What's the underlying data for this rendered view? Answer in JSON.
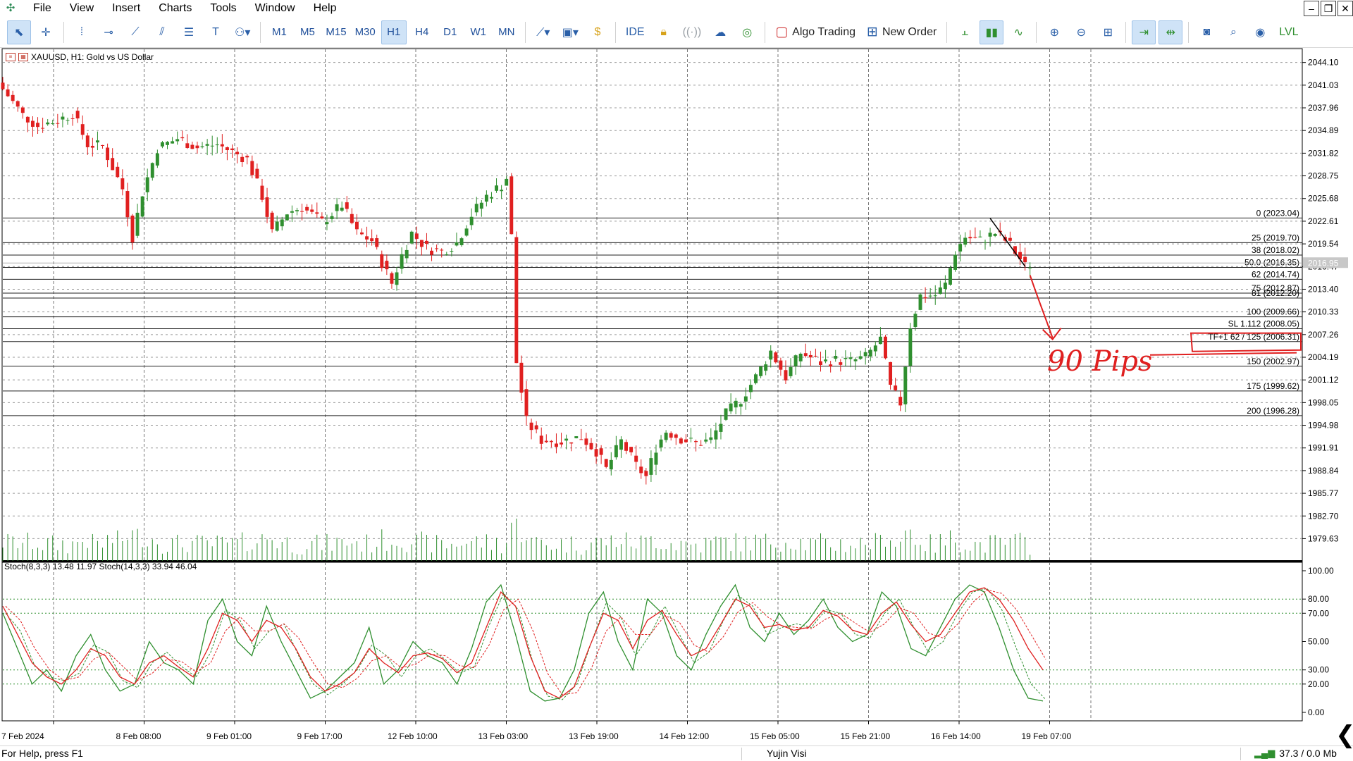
{
  "menu": {
    "items": [
      "File",
      "View",
      "Insert",
      "Charts",
      "Tools",
      "Window",
      "Help"
    ]
  },
  "toolbar": {
    "timeframes": [
      "M1",
      "M5",
      "M15",
      "M30",
      "H1",
      "H4",
      "D1",
      "W1",
      "MN"
    ],
    "active_timeframe": "H1",
    "ide_label": "IDE",
    "algo_trading_label": "Algo Trading",
    "new_order_label": "New Order"
  },
  "chart": {
    "title": "XAUUSD, H1:  Gold vs US Dollar",
    "current_price_label": "2016.95",
    "accent_up": "#2f8f2f",
    "accent_down": "#e02020"
  },
  "chart_data": {
    "type": "candlestick",
    "symbol": "XAUUSD",
    "timeframe": "H1",
    "title": "XAUUSD, H1:  Gold vs US Dollar",
    "ylim": [
      1977.0,
      2045.5
    ],
    "y_ticks": [
      "2044.10",
      "2041.03",
      "2037.96",
      "2034.89",
      "2031.82",
      "2028.75",
      "2025.68",
      "2022.61",
      "2019.54",
      "2016.47",
      "2013.40",
      "2010.33",
      "2007.26",
      "2004.19",
      "2001.12",
      "1998.05",
      "1994.98",
      "1991.91",
      "1988.84",
      "1985.77",
      "1982.70",
      "1979.63"
    ],
    "x_ticks": [
      "7 Feb 2024",
      "8 Feb 08:00",
      "9 Feb 01:00",
      "9 Feb 17:00",
      "12 Feb 10:00",
      "13 Feb 03:00",
      "13 Feb 19:00",
      "14 Feb 12:00",
      "15 Feb 05:00",
      "15 Feb 21:00",
      "16 Feb 14:00",
      "19 Feb 07:00"
    ],
    "grid": true,
    "price_path": [
      {
        "x": 0,
        "y": 2040.5
      },
      {
        "x": 8,
        "y": 2037.0
      },
      {
        "x": 14,
        "y": 2035.5
      },
      {
        "x": 22,
        "y": 2036.3
      },
      {
        "x": 28,
        "y": 2037.2
      },
      {
        "x": 34,
        "y": 2033.0
      },
      {
        "x": 40,
        "y": 2032.8
      },
      {
        "x": 48,
        "y": 2027.0
      },
      {
        "x": 52,
        "y": 2020.5
      },
      {
        "x": 56,
        "y": 2026.5
      },
      {
        "x": 62,
        "y": 2032.5
      },
      {
        "x": 70,
        "y": 2033.8
      },
      {
        "x": 78,
        "y": 2032.6
      },
      {
        "x": 86,
        "y": 2033.0
      },
      {
        "x": 98,
        "y": 2031.0
      },
      {
        "x": 104,
        "y": 2026.0
      },
      {
        "x": 108,
        "y": 2021.0
      },
      {
        "x": 114,
        "y": 2023.8
      },
      {
        "x": 120,
        "y": 2024.5
      },
      {
        "x": 128,
        "y": 2022.5
      },
      {
        "x": 136,
        "y": 2024.8
      },
      {
        "x": 142,
        "y": 2021.0
      },
      {
        "x": 148,
        "y": 2020.0
      },
      {
        "x": 152,
        "y": 2017.0
      },
      {
        "x": 156,
        "y": 2014.2
      },
      {
        "x": 160,
        "y": 2018.0
      },
      {
        "x": 164,
        "y": 2021.0
      },
      {
        "x": 170,
        "y": 2019.0
      },
      {
        "x": 176,
        "y": 2018.5
      },
      {
        "x": 182,
        "y": 2019.7
      },
      {
        "x": 188,
        "y": 2023.5
      },
      {
        "x": 194,
        "y": 2026.0
      },
      {
        "x": 200,
        "y": 2027.5
      },
      {
        "x": 203,
        "y": 2029.0
      },
      {
        "x": 206,
        "y": 2003.5
      },
      {
        "x": 210,
        "y": 1995.5
      },
      {
        "x": 216,
        "y": 1993.0
      },
      {
        "x": 224,
        "y": 1992.8
      },
      {
        "x": 232,
        "y": 1993.4
      },
      {
        "x": 238,
        "y": 1991.5
      },
      {
        "x": 242,
        "y": 1989.0
      },
      {
        "x": 248,
        "y": 1992.8
      },
      {
        "x": 254,
        "y": 1989.5
      },
      {
        "x": 258,
        "y": 1988.0
      },
      {
        "x": 262,
        "y": 1992.0
      },
      {
        "x": 266,
        "y": 1994.2
      },
      {
        "x": 272,
        "y": 1993.2
      },
      {
        "x": 278,
        "y": 1992.5
      },
      {
        "x": 284,
        "y": 1993.0
      },
      {
        "x": 290,
        "y": 1996.5
      },
      {
        "x": 296,
        "y": 1998.5
      },
      {
        "x": 302,
        "y": 2001.5
      },
      {
        "x": 308,
        "y": 2005.0
      },
      {
        "x": 314,
        "y": 2001.5
      },
      {
        "x": 320,
        "y": 2004.8
      },
      {
        "x": 328,
        "y": 2003.5
      },
      {
        "x": 334,
        "y": 2003.8
      },
      {
        "x": 340,
        "y": 2003.6
      },
      {
        "x": 346,
        "y": 2004.2
      },
      {
        "x": 352,
        "y": 2006.6
      },
      {
        "x": 356,
        "y": 2000.0
      },
      {
        "x": 360,
        "y": 1998.0
      },
      {
        "x": 364,
        "y": 2008.5
      },
      {
        "x": 368,
        "y": 2012.5
      },
      {
        "x": 374,
        "y": 2012.6
      },
      {
        "x": 378,
        "y": 2014.0
      },
      {
        "x": 382,
        "y": 2018.5
      },
      {
        "x": 386,
        "y": 2020.5
      },
      {
        "x": 392,
        "y": 2020.0
      },
      {
        "x": 398,
        "y": 2021.0
      },
      {
        "x": 403,
        "y": 2019.8
      },
      {
        "x": 407,
        "y": 2018.0
      },
      {
        "x": 410,
        "y": 2016.5
      },
      {
        "x": 413,
        "y": 2016.9
      }
    ],
    "x_total": 420,
    "fibonacci_levels": [
      {
        "label": "0 (2023.04)",
        "value": 2023.04
      },
      {
        "label": "25 (2019.70)",
        "value": 2019.7
      },
      {
        "label": "38 (2018.02)",
        "value": 2018.02
      },
      {
        "label": "50.0 (2016.35)",
        "value": 2016.35
      },
      {
        "label": "62 (2014.74)",
        "value": 2014.74
      },
      {
        "label": "75 (2012.87)",
        "value": 2012.87
      },
      {
        "label": "81 (2012.20)",
        "value": 2012.2
      },
      {
        "label": "100 (2009.66)",
        "value": 2009.66
      },
      {
        "label": "SL 1.112 (2008.05)",
        "value": 2008.05
      },
      {
        "label": "TF+1 62 / 125 (2006.31)",
        "value": 2006.31
      },
      {
        "label": "150 (2002.97)",
        "value": 2002.97
      },
      {
        "label": "175 (1999.62)",
        "value": 1999.62
      },
      {
        "label": "200 (1996.28)",
        "value": 1996.28
      }
    ],
    "annotation_text": "90 Pips",
    "oscillator": {
      "label": "Stoch(8,3,3) 13.48 11.97 Stoch(14,3,3) 33.94 46.04",
      "ylim": [
        0,
        100
      ],
      "y_ticks": [
        "100.00",
        "80.00",
        "70.00",
        "50.00",
        "30.00",
        "20.00",
        "0.00"
      ],
      "levels": [
        80,
        70,
        30,
        20
      ],
      "series": [
        {
          "values": [
            70,
            45,
            20,
            30,
            15,
            40,
            55,
            30,
            15,
            20,
            50,
            35,
            30,
            20,
            65,
            80,
            50,
            40,
            75,
            50,
            30,
            10,
            15,
            25,
            35,
            60,
            20,
            30,
            50,
            40,
            35,
            20,
            45,
            78,
            90,
            55,
            15,
            8,
            10,
            30,
            70,
            85,
            50,
            30,
            80,
            70,
            40,
            30,
            55,
            75,
            90,
            60,
            50,
            70,
            55,
            65,
            80,
            60,
            50,
            55,
            85,
            75,
            45,
            40,
            60,
            80,
            90,
            85,
            60,
            30,
            10,
            8
          ]
        },
        {
          "values": [
            75,
            55,
            35,
            25,
            20,
            30,
            45,
            40,
            25,
            20,
            35,
            40,
            32,
            25,
            45,
            70,
            65,
            50,
            65,
            60,
            45,
            25,
            15,
            20,
            28,
            45,
            35,
            28,
            40,
            42,
            38,
            28,
            35,
            60,
            85,
            75,
            40,
            15,
            10,
            18,
            45,
            70,
            65,
            45,
            65,
            72,
            55,
            40,
            45,
            62,
            80,
            75,
            60,
            62,
            58,
            60,
            72,
            68,
            58,
            55,
            70,
            78,
            62,
            50,
            55,
            70,
            85,
            88,
            80,
            65,
            45,
            30
          ]
        }
      ]
    }
  },
  "status": {
    "help": "For Help, press F1",
    "user": "Yujin Visi",
    "network": "37.3 / 0.0 Mb"
  }
}
